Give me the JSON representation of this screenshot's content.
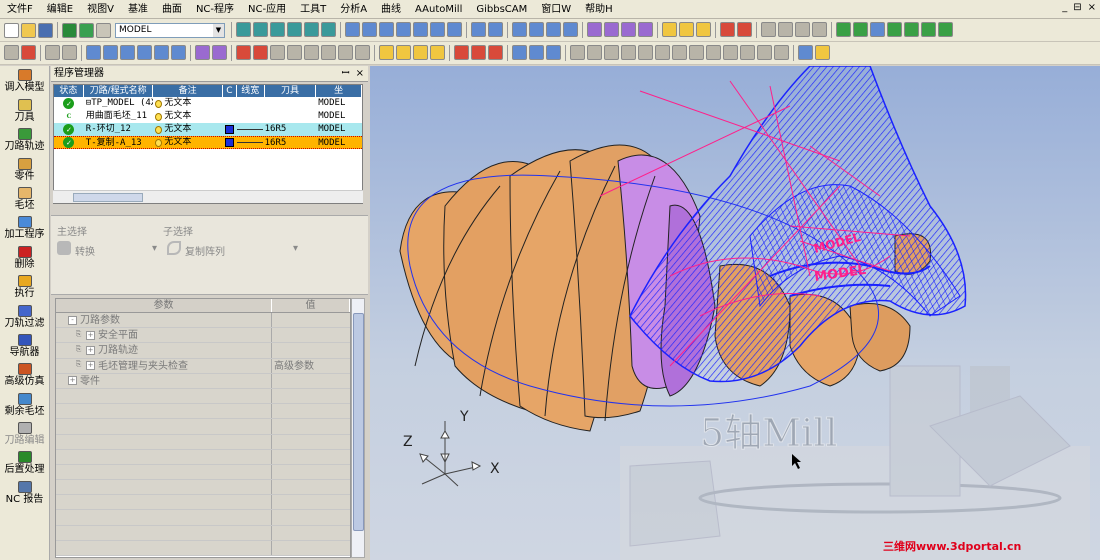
{
  "menubar": {
    "items": [
      "文件F",
      "编辑E",
      "视图V",
      "基准",
      "曲面",
      "NC-程序",
      "NC-应用",
      "工具T",
      "分析A",
      "曲线",
      "AAutoMill",
      "GibbsCAM",
      "窗口W",
      "帮助H"
    ],
    "controls": [
      "_",
      "⊟",
      "×"
    ]
  },
  "toolbar": {
    "layer_value": "MODEL"
  },
  "left_toolbar": {
    "items": [
      {
        "label": "调入模型",
        "disabled": false,
        "color": "#d87a2a"
      },
      {
        "label": "刀具",
        "disabled": false,
        "color": "#e0c050"
      },
      {
        "label": "刀路轨迹",
        "disabled": false,
        "color": "#3a9a3a"
      },
      {
        "label": "零件",
        "disabled": false,
        "color": "#d8a040"
      },
      {
        "label": "毛坯",
        "disabled": false,
        "color": "#e6b66a"
      },
      {
        "label": "加工程序",
        "disabled": false,
        "color": "#4a8ad8"
      },
      {
        "label": "删除",
        "disabled": false,
        "color": "#cc2222"
      },
      {
        "label": "执行",
        "disabled": false,
        "color": "#e8a820"
      },
      {
        "label": "刀轨过滤",
        "disabled": false,
        "color": "#4466cc"
      },
      {
        "label": "导航器",
        "disabled": false,
        "color": "#3355bb"
      },
      {
        "label": "高级仿真",
        "disabled": false,
        "color": "#cc5522"
      },
      {
        "label": "剩余毛坯",
        "disabled": false,
        "color": "#4488cc"
      },
      {
        "label": "刀路编辑",
        "disabled": true,
        "color": "#b0b0b0"
      },
      {
        "label": "后置处理",
        "disabled": false,
        "color": "#2a8a2a"
      },
      {
        "label": "NC 报告",
        "disabled": false,
        "color": "#5577aa"
      }
    ]
  },
  "program_manager": {
    "title": "程序管理器",
    "header_controls": [
      "ꟷ",
      "×"
    ],
    "columns": [
      "状态",
      "刀路/程式名称",
      "备注",
      "C",
      "线宽",
      "刀具",
      "坐"
    ],
    "rows": [
      {
        "status": "ok",
        "name": "TP_MODEL (4X)",
        "note": "无文本",
        "color": "",
        "line": "",
        "tool": "",
        "coord": "MODEL",
        "highlight": "none",
        "prefix": "⊟"
      },
      {
        "status": "c",
        "name": "用曲面毛坯_11",
        "note": "无文本",
        "color": "",
        "line": "",
        "tool": "",
        "coord": "MODEL",
        "highlight": "none",
        "prefix": ""
      },
      {
        "status": "ok",
        "name": "R-环切_12",
        "note": "无文本",
        "color": "#1a2fd8",
        "line": "—",
        "tool": "16R5",
        "coord": "MODEL",
        "highlight": "cyan",
        "prefix": ""
      },
      {
        "status": "ok",
        "name": "T-复制-A_13",
        "note": "无文本",
        "color": "#1a2fd8",
        "line": "—",
        "tool": "16R5",
        "coord": "MODEL",
        "highlight": "orange",
        "prefix": ""
      }
    ]
  },
  "selection": {
    "main_label": "主选择",
    "sub_label": "子选择",
    "main_value": "转换",
    "sub_value": "复制阵列"
  },
  "parameters": {
    "columns": [
      "参数",
      "值"
    ],
    "rows": [
      {
        "label": "刀路参数",
        "value": "",
        "indent": 1,
        "box": "-"
      },
      {
        "label": "安全平面",
        "value": "",
        "indent": 2,
        "box": "+"
      },
      {
        "label": "刀路轨迹",
        "value": "",
        "indent": 2,
        "box": "+"
      },
      {
        "label": "毛坯管理与夹头检查",
        "value": "高级参数",
        "indent": 2,
        "box": "+"
      },
      {
        "label": "零件",
        "value": "",
        "indent": 1,
        "box": "+"
      },
      {
        "label": "",
        "value": "",
        "indent": 0,
        "box": ""
      },
      {
        "label": "",
        "value": "",
        "indent": 0,
        "box": ""
      },
      {
        "label": "",
        "value": "",
        "indent": 0,
        "box": ""
      },
      {
        "label": "",
        "value": "",
        "indent": 0,
        "box": ""
      },
      {
        "label": "",
        "value": "",
        "indent": 0,
        "box": ""
      },
      {
        "label": "",
        "value": "",
        "indent": 0,
        "box": ""
      },
      {
        "label": "",
        "value": "",
        "indent": 0,
        "box": ""
      },
      {
        "label": "",
        "value": "",
        "indent": 0,
        "box": ""
      },
      {
        "label": "",
        "value": "",
        "indent": 0,
        "box": ""
      },
      {
        "label": "",
        "value": "",
        "indent": 0,
        "box": ""
      },
      {
        "label": "",
        "value": "",
        "indent": 0,
        "box": ""
      }
    ]
  },
  "viewport": {
    "axes": {
      "x": "X",
      "y": "Y",
      "z": "Z"
    },
    "background_text": "5轴Mill",
    "toolpath_labels": [
      "MODEL",
      "MODEL"
    ],
    "colors": {
      "part": "#e0a066",
      "pocket": "#c57fe0",
      "toolpath": "#1a22ff",
      "rapid": "#ff1f8a"
    }
  },
  "watermark": "三维网www.3dportal.cn"
}
